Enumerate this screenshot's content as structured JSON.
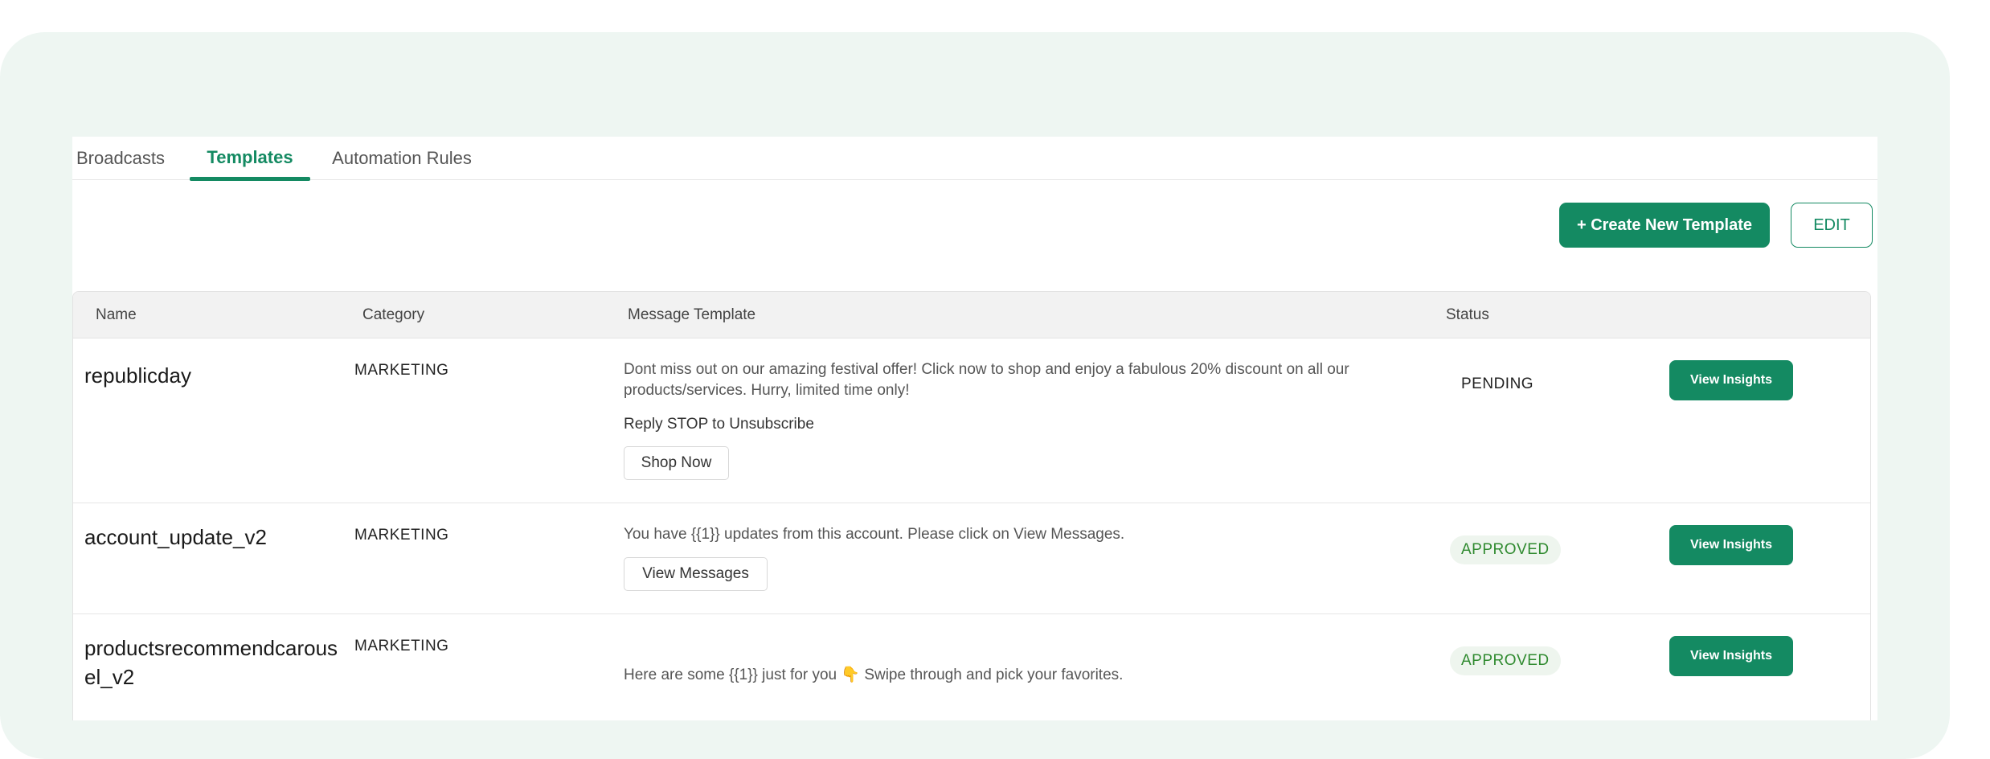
{
  "tabs": [
    {
      "label": "Broadcasts"
    },
    {
      "label": "Templates",
      "active": true
    },
    {
      "label": "Automation Rules"
    }
  ],
  "actions": {
    "create_label": "+ Create New Template",
    "edit_label": "EDIT"
  },
  "table": {
    "headers": {
      "name": "Name",
      "category": "Category",
      "message": "Message Template",
      "status": "Status"
    },
    "rows": [
      {
        "name": "republicday",
        "category": "MARKETING",
        "message": "Dont miss out on our amazing festival offer! Click now to shop and enjoy a fabulous 20% discount on all our products/services. Hurry, limited time only!",
        "footer": "Reply STOP to Unsubscribe",
        "button": "Shop Now",
        "status": "PENDING",
        "action": "View Insights"
      },
      {
        "name": "account_update_v2",
        "category": "MARKETING",
        "message": "You have {{1}} updates from this account. Please click on View Messages.",
        "button": "View Messages",
        "status": "APPROVED",
        "action": "View Insights"
      },
      {
        "name": "productsrecommendcarousel_v2",
        "category": "MARKETING",
        "message": "Here are some {{1}} just for you 👇 Swipe through and pick your favorites.",
        "status": "APPROVED",
        "action": "View Insights"
      }
    ]
  },
  "colors": {
    "accent": "#148a62",
    "approved_text": "#2f8a2f",
    "approved_bg": "#eef5ee",
    "background": "#eef6f2"
  }
}
